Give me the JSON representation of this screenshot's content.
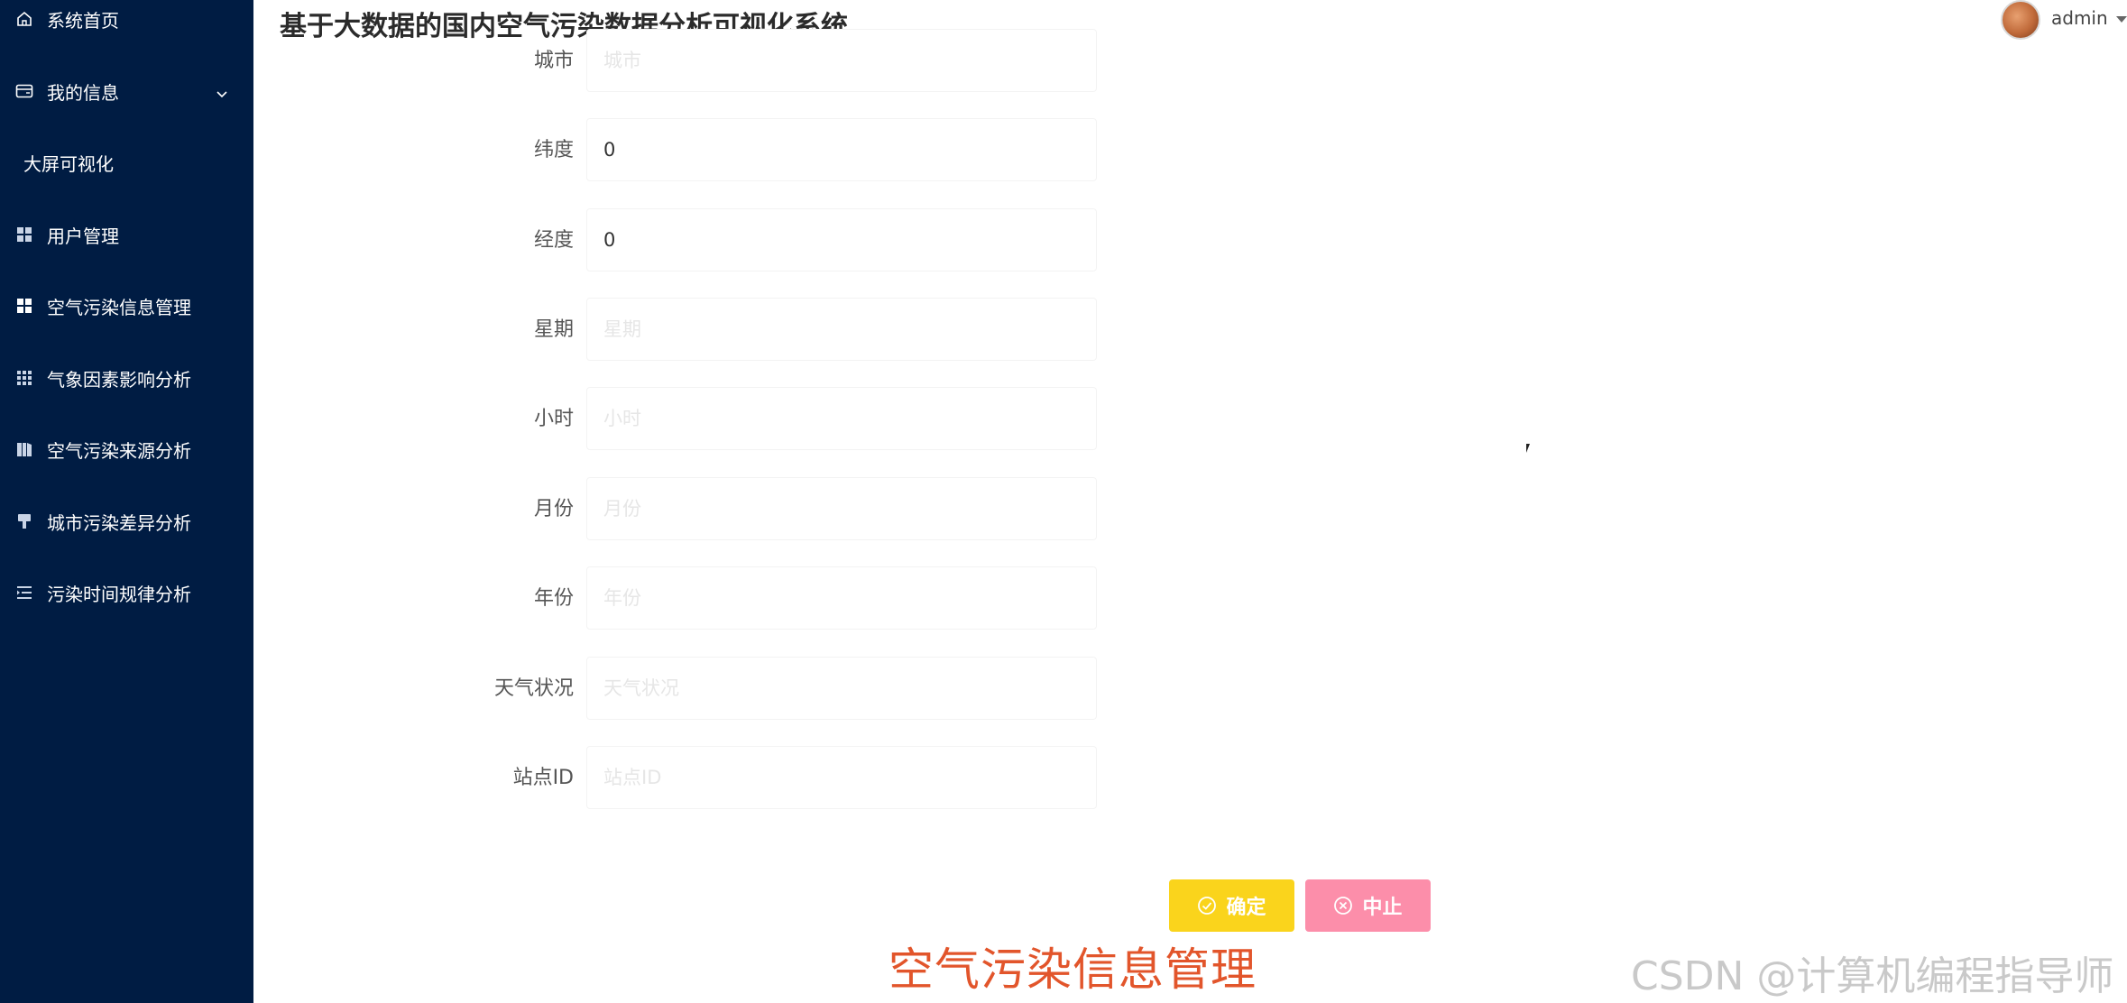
{
  "header": {
    "title": "基于大数据的国内空气污染数据分析可视化系统",
    "username": "admin"
  },
  "sidebar": {
    "items": [
      {
        "label": "系统首页",
        "icon": "home-icon"
      },
      {
        "label": "我的信息",
        "icon": "wallet-icon",
        "expandable": true
      },
      {
        "label": "大屏可视化"
      },
      {
        "label": "用户管理",
        "icon": "grid-icon"
      },
      {
        "label": "空气污染信息管理",
        "icon": "grid-icon",
        "active": true
      },
      {
        "label": "气象因素影响分析",
        "icon": "grid-dots-icon"
      },
      {
        "label": "空气污染来源分析",
        "icon": "book-icon"
      },
      {
        "label": "城市污染差异分析",
        "icon": "brush-icon"
      },
      {
        "label": "污染时间规律分析",
        "icon": "list-indent-icon"
      }
    ]
  },
  "form": {
    "fields": [
      {
        "label": "城市",
        "value": "",
        "placeholder": "城市"
      },
      {
        "label": "纬度",
        "value": "0",
        "placeholder": ""
      },
      {
        "label": "经度",
        "value": "0",
        "placeholder": ""
      },
      {
        "label": "星期",
        "value": "",
        "placeholder": "星期"
      },
      {
        "label": "小时",
        "value": "",
        "placeholder": "小时"
      },
      {
        "label": "月份",
        "value": "",
        "placeholder": "月份"
      },
      {
        "label": "年份",
        "value": "",
        "placeholder": "年份"
      },
      {
        "label": "天气状况",
        "value": "",
        "placeholder": "天气状况"
      },
      {
        "label": "站点ID",
        "value": "",
        "placeholder": "站点ID"
      }
    ]
  },
  "actions": {
    "confirm_label": "确定",
    "cancel_label": "中止"
  },
  "caption": "空气污染信息管理",
  "watermark": "CSDN @计算机编程指导师",
  "colors": {
    "sidebar_bg": "#001c43",
    "confirm_bg": "#fad41c",
    "cancel_bg": "#fc8eaa",
    "caption": "#e2552b"
  }
}
